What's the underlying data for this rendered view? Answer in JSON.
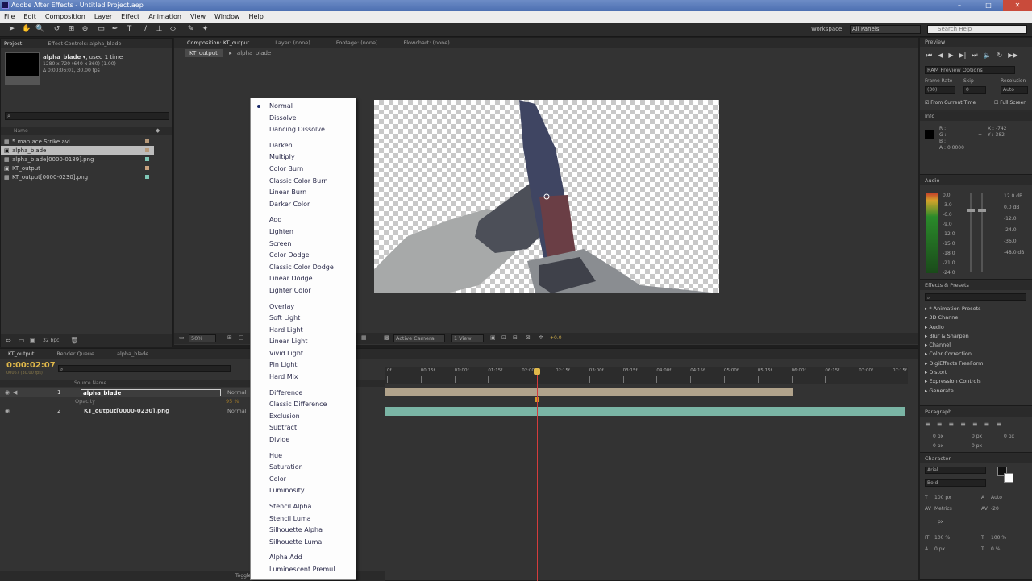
{
  "window": {
    "title": "Adobe After Effects - Untitled Project.aep",
    "min": "–",
    "max": "□",
    "close": "✕"
  },
  "menu": [
    "File",
    "Edit",
    "Composition",
    "Layer",
    "Effect",
    "Animation",
    "View",
    "Window",
    "Help"
  ],
  "toolbar": {
    "workspace_label": "Workspace:",
    "workspace_value": "All Panels",
    "search_placeholder": "Search Help"
  },
  "project": {
    "tab": "Project",
    "effect_tab": "Effect Controls: alpha_blade",
    "item_name": "alpha_blade ▾",
    "item_used": ", used 1 time",
    "item_dims": "1280 x 720 (640 x 360) (1.00)",
    "item_dur": "Δ 0:00:06:01, 30.00 fps",
    "col_name": "Name",
    "items": [
      {
        "name": "5 man ace Strike.avi",
        "color": "#b89a7a"
      },
      {
        "name": "alpha_blade",
        "color": "#b89a7a"
      },
      {
        "name": "alpha_blade[0000-0189].png",
        "color": "#7fc7b6"
      },
      {
        "name": "KT_output",
        "color": "#c9a27e"
      },
      {
        "name": "KT_output[0000-0230].png",
        "color": "#7fc7b6"
      }
    ],
    "bpc": "32 bpc"
  },
  "comp": {
    "tab": "Composition: KT_output",
    "layer_tab": "Layer: (none)",
    "footage_tab": "Footage: (none)",
    "flowchart_tab": "Flowchart: (none)",
    "breadcrumb1": "KT_output",
    "breadcrumb2": "alpha_blade",
    "zoom": "50%",
    "camera": "Active Camera",
    "views": "1 View",
    "exposure": "+0.0"
  },
  "blend_menu": {
    "groups": [
      [
        "Normal",
        "Dissolve",
        "Dancing Dissolve"
      ],
      [
        "Darken",
        "Multiply",
        "Color Burn",
        "Classic Color Burn",
        "Linear Burn",
        "Darker Color"
      ],
      [
        "Add",
        "Lighten",
        "Screen",
        "Color Dodge",
        "Classic Color Dodge",
        "Linear Dodge",
        "Lighter Color"
      ],
      [
        "Overlay",
        "Soft Light",
        "Hard Light",
        "Linear Light",
        "Vivid Light",
        "Pin Light",
        "Hard Mix"
      ],
      [
        "Difference",
        "Classic Difference",
        "Exclusion",
        "Subtract",
        "Divide"
      ],
      [
        "Hue",
        "Saturation",
        "Color",
        "Luminosity"
      ],
      [
        "Stencil Alpha",
        "Stencil Luma",
        "Silhouette Alpha",
        "Silhouette Luma"
      ],
      [
        "Alpha Add",
        "Luminescent Premul"
      ]
    ],
    "selected": "Normal"
  },
  "timeline": {
    "tabs": [
      "KT_output",
      "Render Queue",
      "alpha_blade"
    ],
    "timecode": "0:00:02:07",
    "frames": "00067 (30.00 fps)",
    "col_source": "Source Name",
    "layers": [
      {
        "num": "1",
        "name": "alpha_blade",
        "mode": "Normal"
      },
      {
        "num": "2",
        "name": "KT_output[0000-0230].png",
        "mode": "Normal"
      }
    ],
    "opacity_label": "Opacity",
    "opacity_value": "95 %",
    "ruler": [
      "0f",
      "00:15f",
      "01:00f",
      "01:15f",
      "02:00f",
      "02:15f",
      "03:00f",
      "03:15f",
      "04:00f",
      "04:15f",
      "05:00f",
      "05:15f",
      "06:00f",
      "06:15f",
      "07:00f",
      "07:15f"
    ],
    "toggle": "Toggle Switches / Modes"
  },
  "preview": {
    "title": "Preview",
    "ram": "RAM Preview Options",
    "frame_rate": "Frame Rate",
    "skip": "Skip",
    "resolution": "Resolution",
    "fr_val": "(30)",
    "skip_val": "0",
    "res_val": "Auto",
    "from_current": "From Current Time",
    "full_screen": "Full Screen"
  },
  "info": {
    "title": "Info",
    "r": "R :",
    "g": "G :",
    "b": "B :",
    "a": "A : 0.0000",
    "x": "X : -742",
    "y": "Y : 382"
  },
  "audio": {
    "title": "Audio",
    "left": [
      "0.0",
      "-3.0",
      "-6.0",
      "-9.0",
      "-12.0",
      "-15.0",
      "-18.0",
      "-21.0",
      "-24.0"
    ],
    "right": [
      "12.0 dB",
      "0.0 dB",
      "-12.0",
      "-24.0",
      "-36.0",
      "-48.0 dB"
    ]
  },
  "effects": {
    "title": "Effects & Presets",
    "items": [
      "* Animation Presets",
      "3D Channel",
      "Audio",
      "Blur & Sharpen",
      "Channel",
      "Color Correction",
      "DigiEffects FreeForm",
      "Distort",
      "Expression Controls",
      "Generate"
    ]
  },
  "paragraph": {
    "title": "Paragraph",
    "px1": "0 px",
    "px2": "0 px",
    "px3": "0 px",
    "px4": "0 px",
    "px5": "0 px"
  },
  "character": {
    "title": "Character",
    "font": "Arial",
    "style": "Bold",
    "size": "100 px",
    "leading": "Auto",
    "kerning": "Metrics",
    "tracking": "-20",
    "stroke": "px",
    "vscale": "100 %",
    "hscale": "100 %",
    "baseline": "0 px",
    "tsume": "0 %"
  }
}
